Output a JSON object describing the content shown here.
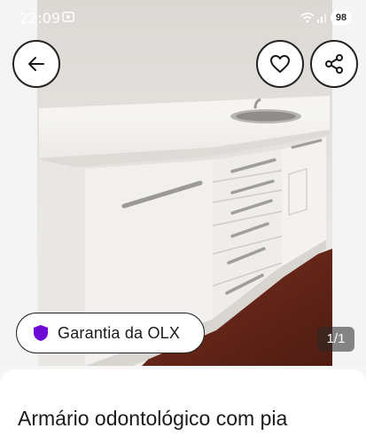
{
  "status_bar": {
    "time": "22:09",
    "battery": "98"
  },
  "product_image": {
    "description_icon": "cabinet-photo",
    "counter": "1/1"
  },
  "guarantee_badge": {
    "label": "Garantia da OLX",
    "icon": "shield-icon",
    "color": "#6e0ad6"
  },
  "actions": {
    "back_icon": "arrow-left-icon",
    "favorite_icon": "heart-icon",
    "share_icon": "share-icon"
  },
  "listing": {
    "title": "Armário odontológico com pia"
  }
}
